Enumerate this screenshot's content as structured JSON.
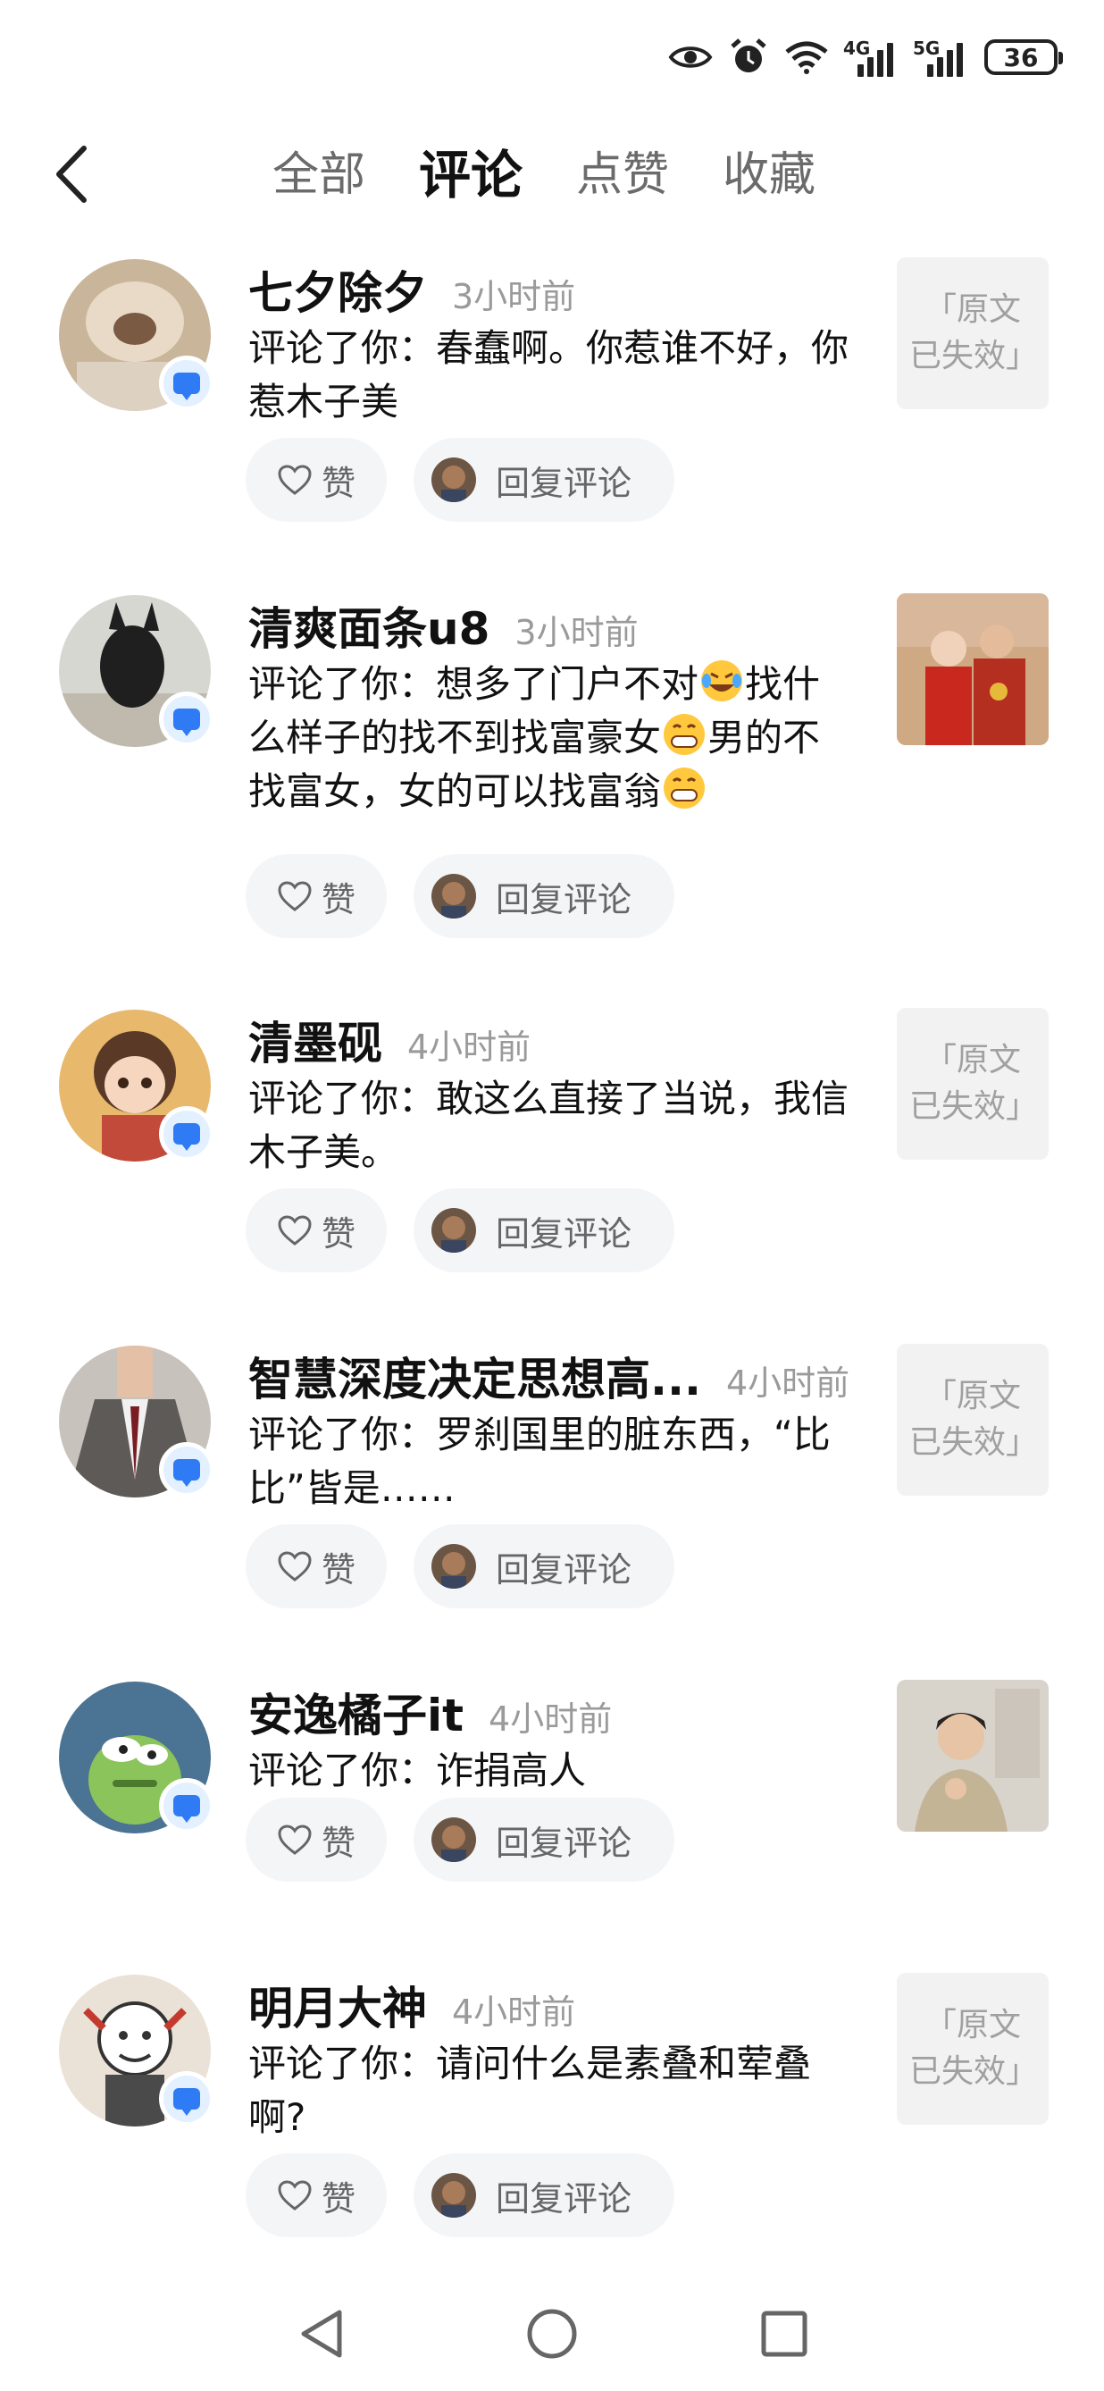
{
  "status_bar": {
    "network_1": "4G",
    "network_2": "5G",
    "battery": "36",
    "icons": [
      "eye-icon",
      "alarm-icon",
      "wifi-icon",
      "signal-icon",
      "signal-icon",
      "battery-icon"
    ]
  },
  "nav": {
    "tabs": [
      {
        "label": "全部"
      },
      {
        "label": "评论"
      },
      {
        "label": "点赞"
      },
      {
        "label": "收藏"
      }
    ],
    "active_tab": "评论"
  },
  "actions": {
    "like": "赞",
    "reply": "回复评论"
  },
  "comments": [
    {
      "user": "七夕除夕",
      "time": "3小时前",
      "text": "评论了你：春蠢啊。你惹谁不好，你惹木子美",
      "thumb": "「原文已失效」"
    },
    {
      "user": "清爽面条u8",
      "time": "3小时前",
      "text_1": "评论了你：想多了门户不对",
      "text_2": "找什么样子的找不到找富豪女",
      "text_3": "男的不找富女，女的可以找富翁",
      "thumb": ""
    },
    {
      "user": "清墨砚",
      "time": "4小时前",
      "text": "评论了你：敢这么直接了当说，我信木子美。",
      "thumb": "「原文已失效」"
    },
    {
      "user": "智慧深度决定思想高...",
      "time": "4小时前",
      "text": "评论了你：罗刹国里的脏东西，“比比”皆是……",
      "thumb": "「原文已失效」"
    },
    {
      "user": "安逸橘子it",
      "time": "4小时前",
      "text": "评论了你：诈捐高人",
      "thumb": ""
    },
    {
      "user": "明月大神",
      "time": "4小时前",
      "text": "评论了你：请问什么是素叠和荤叠啊?",
      "thumb": "「原文已失效」"
    }
  ],
  "colors": {
    "accent": "#2f7bf5",
    "pill_bg": "#f4f5f7",
    "muted": "#9a9a9a"
  }
}
